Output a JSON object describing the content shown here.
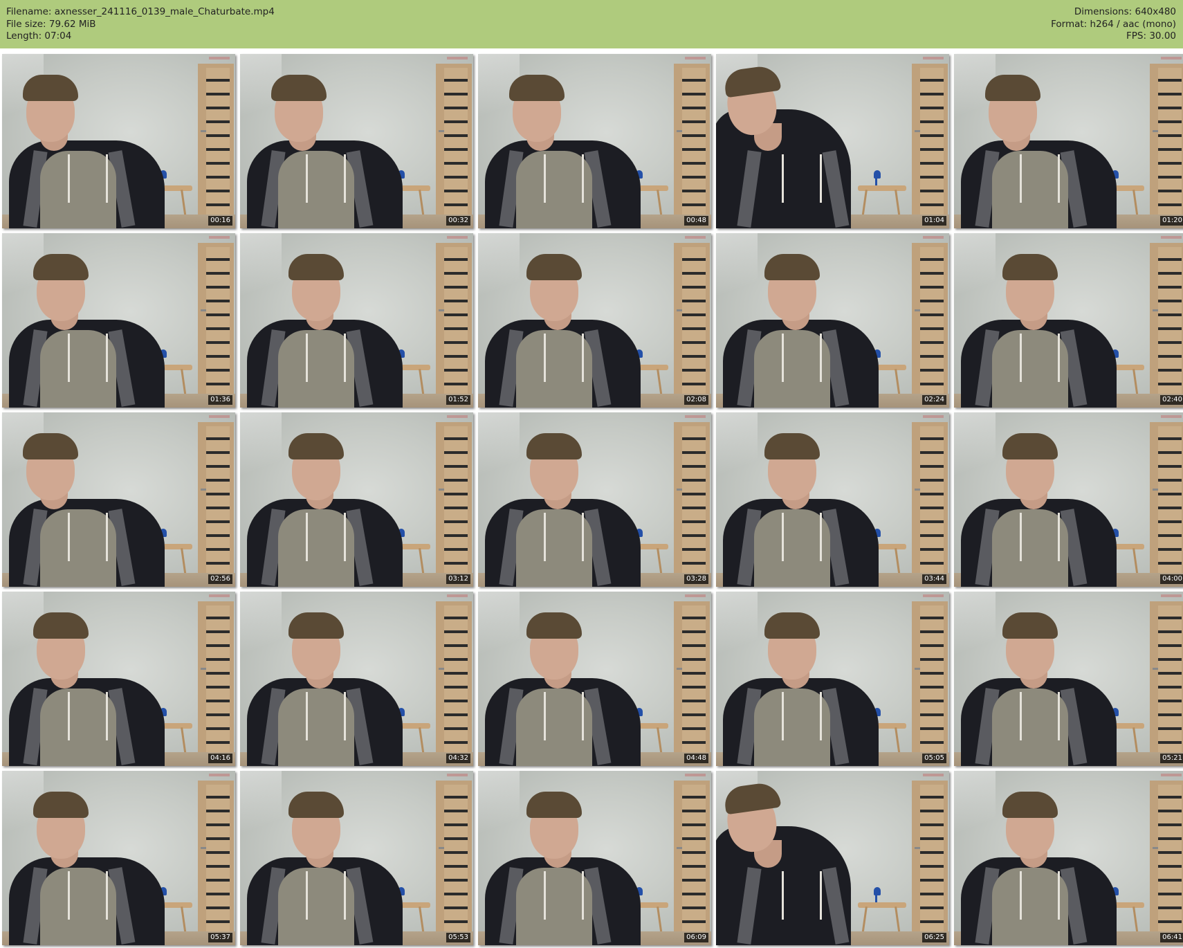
{
  "info_left": {
    "filename": "Filename: axnesser_241116_0139_male_Chaturbate.mp4",
    "file_size": "File size: 79.62 MiB",
    "length": "Length: 07:04"
  },
  "info_right": {
    "dimensions": "Dimensions: 640x480",
    "format": "Format: h264 / aac (mono)",
    "fps": "FPS: 30.00"
  },
  "thumbnails": [
    {
      "timestamp": "00:16"
    },
    {
      "timestamp": "00:32"
    },
    {
      "timestamp": "00:48"
    },
    {
      "timestamp": "01:04"
    },
    {
      "timestamp": "01:20"
    },
    {
      "timestamp": "01:36"
    },
    {
      "timestamp": "01:52"
    },
    {
      "timestamp": "02:08"
    },
    {
      "timestamp": "02:24"
    },
    {
      "timestamp": "02:40"
    },
    {
      "timestamp": "02:56"
    },
    {
      "timestamp": "03:12"
    },
    {
      "timestamp": "03:28"
    },
    {
      "timestamp": "03:44"
    },
    {
      "timestamp": "04:00"
    },
    {
      "timestamp": "04:16"
    },
    {
      "timestamp": "04:32"
    },
    {
      "timestamp": "04:48"
    },
    {
      "timestamp": "05:05"
    },
    {
      "timestamp": "05:21"
    },
    {
      "timestamp": "05:37"
    },
    {
      "timestamp": "05:53"
    },
    {
      "timestamp": "06:09"
    },
    {
      "timestamp": "06:25"
    },
    {
      "timestamp": "06:41"
    }
  ],
  "colors": {
    "header_bg": "#afcb7d",
    "timestamp_bg": "#000000",
    "timestamp_text": "#ffffff"
  }
}
